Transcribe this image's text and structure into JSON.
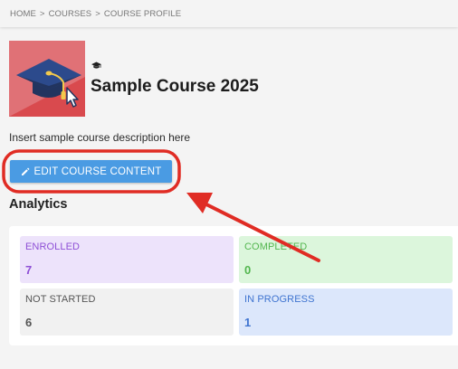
{
  "breadcrumb": {
    "home": "HOME",
    "courses": "COURSES",
    "current": "COURSE PROFILE",
    "separator": ">"
  },
  "course": {
    "title": "Sample Course 2025",
    "description": "Insert sample course description here",
    "thumbnail_icon": "graduation-cap-cursor-icon",
    "type_icon": "graduation-cap-icon"
  },
  "actions": {
    "edit_label": "EDIT COURSE CONTENT",
    "edit_icon": "pencil-icon"
  },
  "analytics": {
    "title": "Analytics",
    "stats": [
      {
        "label": "ENROLLED",
        "value": "7",
        "bg": "#ede3fb",
        "color": "#8e4fd6"
      },
      {
        "label": "COMPLETED",
        "value": "0",
        "bg": "#dcf6dc",
        "color": "#53b64f"
      },
      {
        "label": "NOT STARTED",
        "value": "6",
        "bg": "#f1f1f1",
        "color": "#555555"
      },
      {
        "label": "IN PROGRESS",
        "value": "1",
        "bg": "#dce7fb",
        "color": "#3f74d0"
      }
    ]
  },
  "colors": {
    "accent": "#4a9be3",
    "annotation": "#e02c24",
    "thumb_bg": "#e07176"
  }
}
